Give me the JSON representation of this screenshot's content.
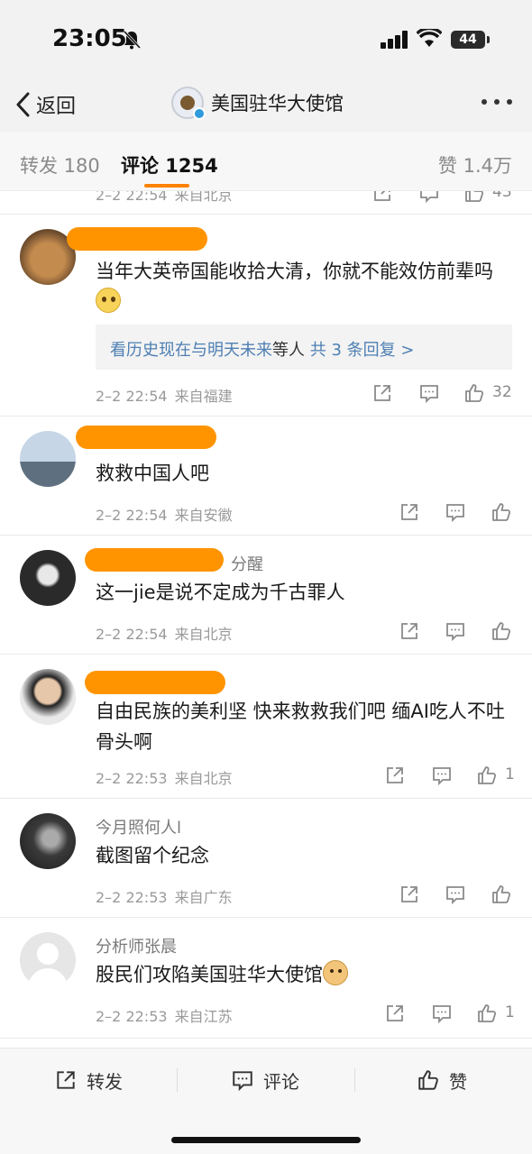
{
  "status": {
    "time": "23:05",
    "battery": "44"
  },
  "nav": {
    "back_label": "返回",
    "account_name": "美国驻华大使馆"
  },
  "tabs": {
    "repost": "转发 180",
    "comment": "评论 1254",
    "like": "赞 1.4万"
  },
  "clipped_top": {
    "date": "2–2 22:54",
    "loc": "来自北京",
    "likes": "43"
  },
  "comments": [
    {
      "username_visible": "",
      "text": "当年大英帝国能收拾大清，你就不能效仿前辈吗",
      "reply_names": "看历史现在与明天未来",
      "reply_mid": "等人",
      "reply_count": "共 3 条回复 >",
      "date": "2–2 22:54",
      "loc": "来自福建",
      "likes": "32"
    },
    {
      "username_visible": "",
      "text": "救救中国人吧",
      "date": "2–2 22:54",
      "loc": "来自安徽",
      "likes": ""
    },
    {
      "username_visible": "分醒",
      "text": "这一jie是说不定成为千古罪人",
      "date": "2–2 22:54",
      "loc": "来自北京",
      "likes": ""
    },
    {
      "username_visible": "",
      "text": "自由民族的美利坚 快来救救我们吧 缅AI吃人不吐骨头啊",
      "date": "2–2 22:53",
      "loc": "来自北京",
      "likes": "1"
    },
    {
      "username_visible": "今月照何人l",
      "text": "截图留个纪念",
      "date": "2–2 22:53",
      "loc": "来自广东",
      "likes": ""
    },
    {
      "username_visible": "分析师张晨",
      "text": "股民们攻陷美国驻华大使馆",
      "date": "2–2 22:53",
      "loc": "来自江苏",
      "likes": "1"
    }
  ],
  "bottom": {
    "repost": "转发",
    "comment": "评论",
    "like": "赞"
  },
  "colors": {
    "accent": "#ff8200",
    "link": "#4e7fb3",
    "redaction": "#ff9400"
  },
  "icons": [
    "bell-off-icon",
    "signal-icon",
    "wifi-icon",
    "back-chevron-icon",
    "more-icon",
    "share-icon",
    "comment-icon",
    "like-icon"
  ]
}
